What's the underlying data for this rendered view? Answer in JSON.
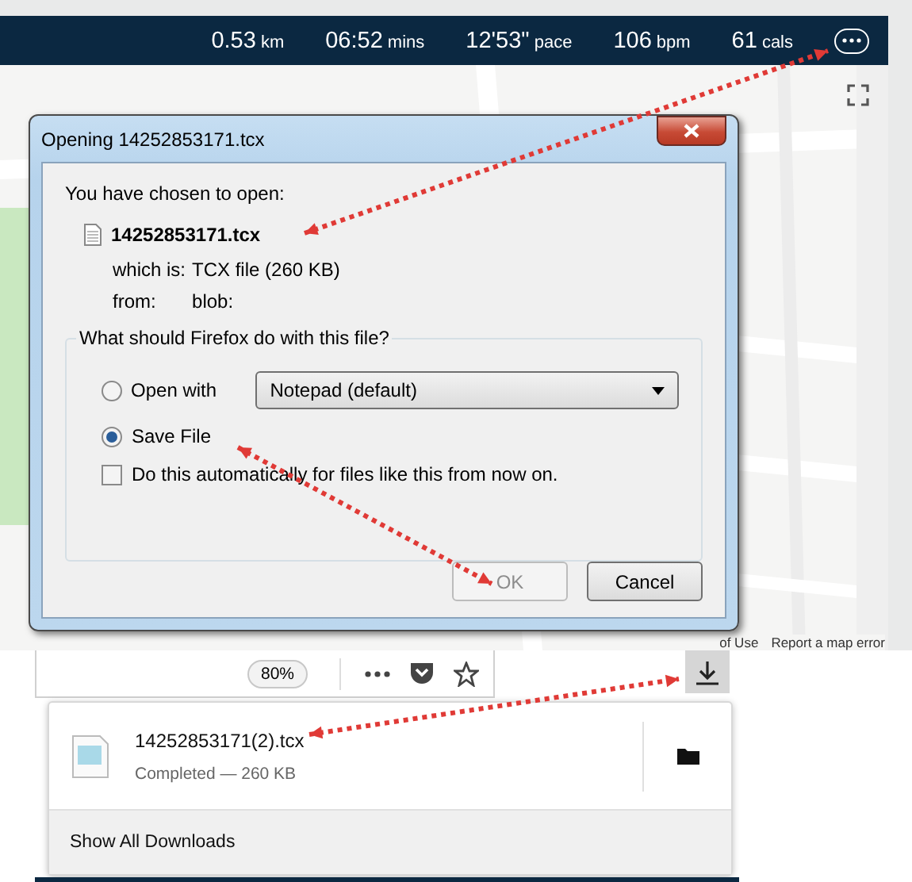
{
  "activity_bar": {
    "stats": [
      {
        "value": "0.53",
        "unit": "km"
      },
      {
        "value": "06:52",
        "unit": "mins"
      },
      {
        "value": "12'53\"",
        "unit": "pace"
      },
      {
        "value": "106",
        "unit": "bpm"
      },
      {
        "value": "61",
        "unit": "cals"
      }
    ]
  },
  "map": {
    "kind": "picture",
    "footer_links": [
      "of Use",
      "Report a map error"
    ]
  },
  "dialog": {
    "title": "Opening 14252853171.tcx",
    "intro": "You have chosen to open:",
    "file_name": "14252853171.tcx",
    "details": [
      {
        "label": "which is:",
        "value": "TCX file (260 KB)"
      },
      {
        "label": "from:",
        "value": "blob:"
      }
    ],
    "question": "What should Firefox do with this file?",
    "options": [
      {
        "label": "Open with",
        "selected": false
      },
      {
        "label": "Save File",
        "selected": true
      }
    ],
    "app_select": "Notepad (default)",
    "remember": {
      "label": "Do this automatically for files like this from now on.",
      "checked": false
    },
    "buttons": [
      {
        "label": "OK",
        "disabled": true
      },
      {
        "label": "Cancel",
        "disabled": false
      }
    ]
  },
  "toolbar": {
    "zoom": "80%"
  },
  "downloads": {
    "items": [
      {
        "name": "14252853171(2).tcx",
        "status": "Completed — 260 KB"
      }
    ],
    "footer": "Show All Downloads"
  }
}
